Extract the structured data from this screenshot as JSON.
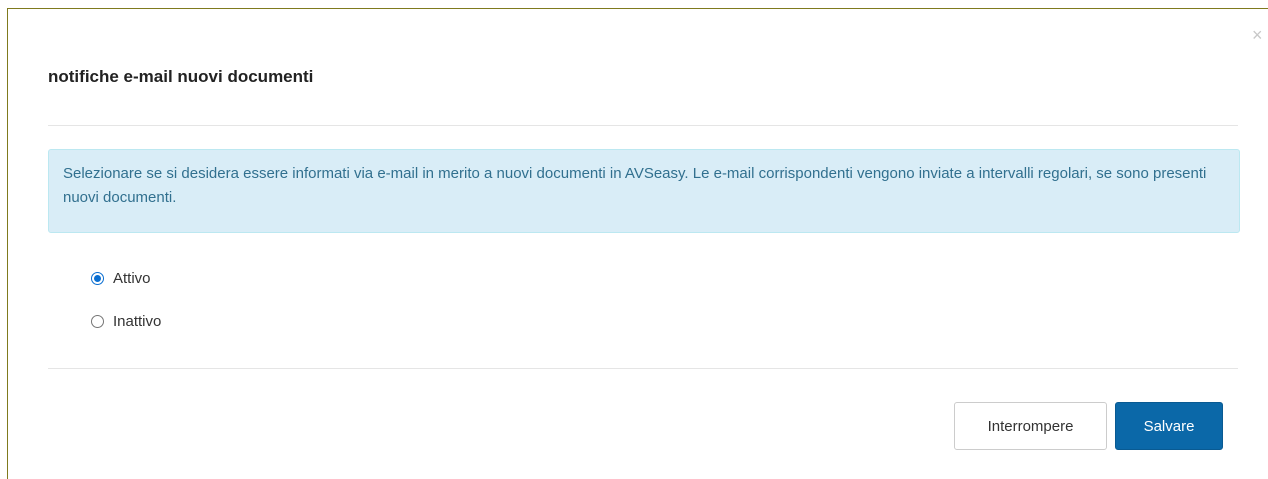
{
  "modal": {
    "close_label": "×",
    "title": "notifiche e-mail nuovi documenti",
    "info_text": "Selezionare se si desidera essere informati via e-mail in merito a nuovi documenti in AVSeasy. Le e-mail corrispondenti vengono inviate a intervalli regolari, se sono presenti nuovi documenti.",
    "options": [
      {
        "label": "Attivo",
        "checked": true
      },
      {
        "label": "Inattivo",
        "checked": false
      }
    ],
    "buttons": {
      "cancel_label": "Interrompere",
      "save_label": "Salvare"
    }
  },
  "colors": {
    "frame_border": "#7f7a1e",
    "alert_bg": "#d9edf7",
    "alert_text": "#31708f",
    "primary_button": "#0b68a8",
    "radio_accent": "#0a6ed1"
  }
}
